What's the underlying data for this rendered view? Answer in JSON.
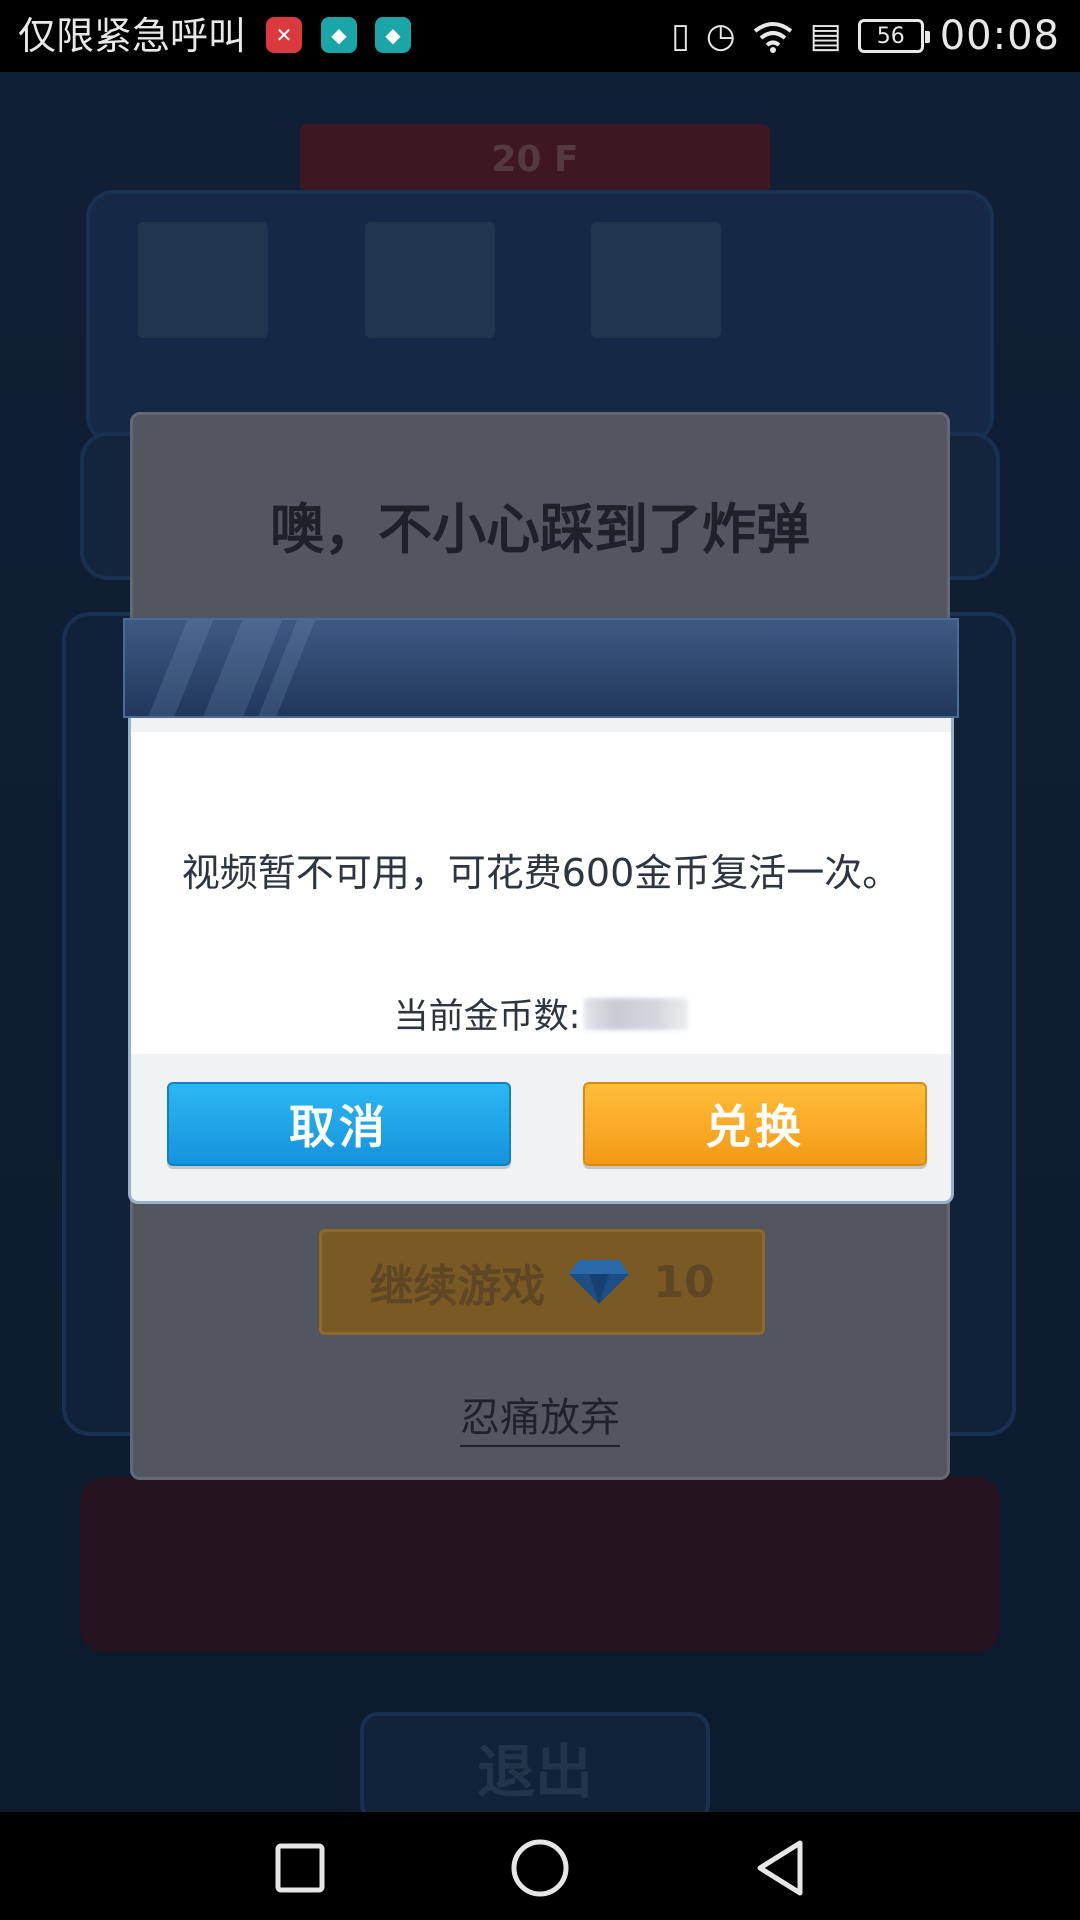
{
  "status_bar": {
    "carrier": "仅限紧急呼叫",
    "battery": "56",
    "time": "00:08"
  },
  "background_game": {
    "floor": "20 F",
    "exit_label": "退出"
  },
  "bomb_dialog": {
    "title": "噢，不小心踩到了炸弹",
    "continue_label": "继续游戏",
    "continue_cost": "10",
    "give_up_label": "忍痛放弃"
  },
  "confirm_dialog": {
    "message": "视频暂不可用，可花费600金币复活一次。",
    "coin_label": "当前金币数:",
    "cancel_label": "取消",
    "exchange_label": "兑换"
  },
  "colors": {
    "cancel_button": "#1fa5ea",
    "exchange_button": "#f8aa24"
  }
}
